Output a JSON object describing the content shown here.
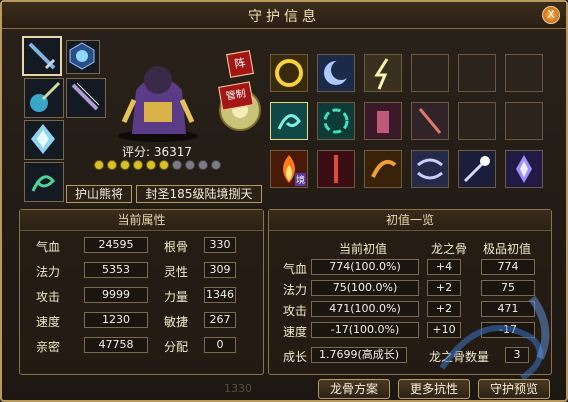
{
  "window": {
    "title": "守护信息",
    "close_label": "X"
  },
  "character": {
    "score_label": "评分:",
    "score_value": "36317",
    "stamps": [
      "阵",
      "管制"
    ],
    "tags": [
      "护山熊将",
      "封圣185级陆境捌天"
    ],
    "star_levels": {
      "filled": 6,
      "total": 10
    }
  },
  "skills": {
    "badge_label": "境"
  },
  "attributes": {
    "header": "当前属性",
    "left": [
      {
        "label": "气血",
        "value": "24595"
      },
      {
        "label": "法力",
        "value": "5353"
      },
      {
        "label": "攻击",
        "value": "9999"
      },
      {
        "label": "速度",
        "value": "1230"
      },
      {
        "label": "亲密",
        "value": "47758"
      }
    ],
    "right": [
      {
        "label": "根骨",
        "value": "330"
      },
      {
        "label": "灵性",
        "value": "309"
      },
      {
        "label": "力量",
        "value": "1346"
      },
      {
        "label": "敏捷",
        "value": "267"
      },
      {
        "label": "分配",
        "value": "0"
      }
    ]
  },
  "initial": {
    "header": "初值一览",
    "col_current": "当前初值",
    "col_dragon": "龙之骨",
    "col_max": "极品初值",
    "rows": [
      {
        "label": "气血",
        "current": "774(100.0%)",
        "dragon": "+4",
        "max": "774"
      },
      {
        "label": "法力",
        "current": "75(100.0%)",
        "dragon": "+2",
        "max": "75"
      },
      {
        "label": "攻击",
        "current": "471(100.0%)",
        "dragon": "+2",
        "max": "471"
      },
      {
        "label": "速度",
        "current": "-17(100.0%)",
        "dragon": "+10",
        "max": "-17"
      }
    ],
    "growth_label": "成长",
    "growth_value": "1.7699(高成长)",
    "dragon_count_label": "龙之骨数量",
    "dragon_count_value": "3"
  },
  "footer": {
    "ghost_value": "1330"
  },
  "buttons": {
    "dragon_plan": "龙骨方案",
    "more_resist": "更多抗性",
    "guard_preview": "守护预览"
  },
  "colors": {
    "accent": "#b89a5c",
    "title": "#f4e3b5"
  }
}
